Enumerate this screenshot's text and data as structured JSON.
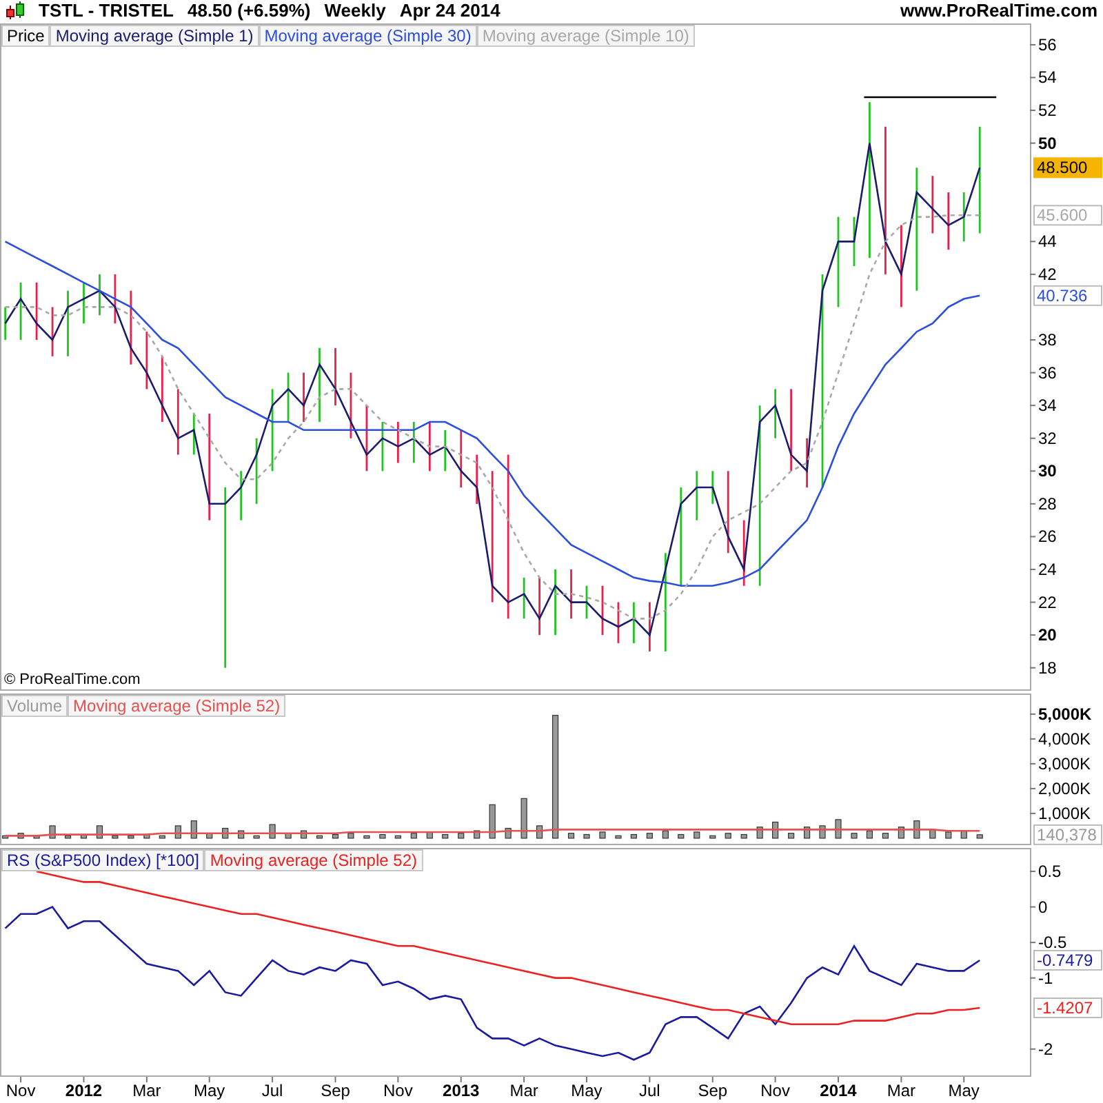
{
  "header": {
    "symbol": "TSTL - TRISTEL",
    "price": "48.50 (+6.59%)",
    "interval": "Weekly",
    "date": "Apr 24 2014",
    "site": "www.ProRealTime.com"
  },
  "panels": [
    {
      "kind": "price",
      "price_label": "Price",
      "copyright": "© ProRealTime.com",
      "chart_data": {
        "type": "line",
        "xlim": [
          2011.778,
          2014.508
        ],
        "ylim": [
          16.6,
          57.3
        ],
        "yticks": [
          56,
          54,
          52,
          50,
          44,
          42,
          38,
          36,
          34,
          32,
          30,
          28,
          26,
          24,
          22,
          20,
          18
        ],
        "ref_lines": [
          {
            "axis": "y",
            "value": 52.8
          }
        ],
        "annotations": [
          "48.500",
          "45.600",
          "40.736"
        ],
        "x": [
          2011.792,
          2011.833,
          2011.875,
          2011.917,
          2011.958,
          2012.0,
          2012.042,
          2012.083,
          2012.125,
          2012.167,
          2012.208,
          2012.25,
          2012.292,
          2012.333,
          2012.375,
          2012.417,
          2012.458,
          2012.5,
          2012.542,
          2012.583,
          2012.625,
          2012.667,
          2012.708,
          2012.75,
          2012.792,
          2012.833,
          2012.875,
          2012.917,
          2012.958,
          2013.0,
          2013.042,
          2013.083,
          2013.125,
          2013.167,
          2013.208,
          2013.25,
          2013.292,
          2013.333,
          2013.375,
          2013.417,
          2013.458,
          2013.5,
          2013.542,
          2013.583,
          2013.625,
          2013.667,
          2013.708,
          2013.75,
          2013.792,
          2013.833,
          2013.875,
          2013.917,
          2013.958,
          2014.0,
          2014.042,
          2014.083,
          2014.125,
          2014.167,
          2014.208,
          2014.25,
          2014.292,
          2014.333,
          2014.375
        ],
        "series": [
          {
            "name": "Moving average (Simple 1)",
            "color": "#1a1a6e",
            "errors": [
              [
                38,
                40
              ],
              [
                38,
                41.5
              ],
              [
                38,
                41.5
              ],
              [
                37,
                40
              ],
              [
                37,
                41
              ],
              [
                39,
                41.5
              ],
              [
                39.5,
                42
              ],
              [
                39,
                42
              ],
              [
                36.5,
                41
              ],
              [
                35,
                38.5
              ],
              [
                33,
                37
              ],
              [
                31,
                35
              ],
              [
                31,
                33.5
              ],
              [
                27,
                33.5
              ],
              [
                18,
                29
              ],
              [
                27,
                30
              ],
              [
                28,
                32
              ],
              [
                30,
                35
              ],
              [
                33,
                36
              ],
              [
                33,
                36
              ],
              [
                33,
                37.5
              ],
              [
                34,
                37.5
              ],
              [
                32,
                36
              ],
              [
                30,
                34
              ],
              [
                30,
                33
              ],
              [
                30.5,
                33
              ],
              [
                30.5,
                33
              ],
              [
                30,
                33
              ],
              [
                30,
                32.5
              ],
              [
                29,
                32.5
              ],
              [
                28,
                31
              ],
              [
                22,
                30
              ],
              [
                21,
                31
              ],
              [
                21,
                23.5
              ],
              [
                20,
                23.5
              ],
              [
                20,
                24
              ],
              [
                21,
                24
              ],
              [
                21,
                23
              ],
              [
                20,
                23
              ],
              [
                19.5,
                22
              ],
              [
                19.5,
                22
              ],
              [
                19,
                22
              ],
              [
                19,
                25
              ],
              [
                23,
                29
              ],
              [
                27,
                30
              ],
              [
                28,
                30
              ],
              [
                25,
                30
              ],
              [
                23,
                27
              ],
              [
                23,
                34
              ],
              [
                32,
                35
              ],
              [
                30,
                35
              ],
              [
                29,
                32
              ],
              [
                29,
                42
              ],
              [
                40,
                45.5
              ],
              [
                42.5,
                45.5
              ],
              [
                43,
                52.5
              ],
              [
                42,
                51
              ],
              [
                40,
                45
              ],
              [
                41,
                48.5
              ],
              [
                44.5,
                48
              ],
              [
                43.5,
                47
              ],
              [
                44,
                47
              ],
              [
                44.5,
                51
              ]
            ],
            "values": [
              39,
              40.5,
              39,
              38,
              40,
              40.5,
              41,
              40,
              37.5,
              36,
              34,
              32,
              32.5,
              28,
              28,
              29,
              31,
              34,
              35,
              34,
              36.5,
              35,
              33,
              31,
              32,
              31.5,
              32,
              31,
              31.5,
              30,
              29,
              23,
              22,
              22.5,
              21,
              23,
              22,
              22,
              21,
              20.5,
              21,
              20,
              24,
              28,
              29,
              29,
              26,
              24,
              33,
              34,
              31,
              30,
              41,
              44,
              44,
              50,
              44,
              42,
              47,
              46,
              45,
              45.5,
              48.5
            ]
          },
          {
            "name": "Moving average (Simple 30)",
            "color": "#2b4de0",
            "values": [
              44,
              43.5,
              43,
              42.5,
              42,
              41.5,
              41,
              40.5,
              40,
              39,
              38,
              37.5,
              36.5,
              35.5,
              34.5,
              34,
              33.5,
              33,
              33,
              32.5,
              32.5,
              32.5,
              32.5,
              32.5,
              32.5,
              32.5,
              32.5,
              33,
              33,
              32.5,
              32,
              31,
              30,
              28.5,
              27.5,
              26.5,
              25.5,
              25,
              24.5,
              24,
              23.5,
              23.3,
              23.2,
              23,
              23,
              23,
              23.2,
              23.5,
              24,
              25,
              26,
              27,
              29,
              31.5,
              33.5,
              35,
              36.5,
              37.5,
              38.5,
              39,
              40,
              40.5,
              40.7
            ]
          },
          {
            "name": "Moving average (Simple 10)",
            "color": "#a8a8a8",
            "line_style": "dashed",
            "values": [
              40,
              40,
              40,
              39.5,
              39.5,
              40,
              40,
              40,
              39.5,
              38.5,
              37,
              35,
              33.5,
              32,
              30.5,
              29.5,
              29.5,
              30.5,
              32,
              33,
              34.5,
              35,
              35,
              34,
              33,
              32.5,
              32,
              31.5,
              31.5,
              31,
              30.5,
              29,
              27,
              25,
              23.5,
              22.5,
              22.5,
              22.3,
              22,
              21.5,
              21,
              21,
              21.5,
              22.5,
              24,
              26,
              27,
              27.5,
              28,
              29,
              30,
              30.5,
              33,
              36,
              39,
              42,
              44,
              45,
              45.5,
              45.5,
              45.6,
              45.6,
              45.6
            ]
          }
        ]
      }
    },
    {
      "kind": "volume",
      "chart_data": {
        "type": "bar",
        "xlim": [
          2011.778,
          2014.508
        ],
        "ylim": [
          -280,
          5830
        ],
        "yticks": [
          {
            "value": 5000,
            "label": "5,000K"
          },
          {
            "value": 4000,
            "label": "4,000K"
          },
          {
            "value": 3000,
            "label": "3,000K"
          },
          {
            "value": 2000,
            "label": "2,000K"
          },
          {
            "value": 1000,
            "label": "1,000K"
          }
        ],
        "annotations": [
          "140,378"
        ],
        "x": [
          2011.792,
          2011.833,
          2011.875,
          2011.917,
          2011.958,
          2012.0,
          2012.042,
          2012.083,
          2012.125,
          2012.167,
          2012.208,
          2012.25,
          2012.292,
          2012.333,
          2012.375,
          2012.417,
          2012.458,
          2012.5,
          2012.542,
          2012.583,
          2012.625,
          2012.667,
          2012.708,
          2012.75,
          2012.792,
          2012.833,
          2012.875,
          2012.917,
          2012.958,
          2013.0,
          2013.042,
          2013.083,
          2013.125,
          2013.167,
          2013.208,
          2013.25,
          2013.292,
          2013.333,
          2013.375,
          2013.417,
          2013.458,
          2013.5,
          2013.542,
          2013.583,
          2013.625,
          2013.667,
          2013.708,
          2013.75,
          2013.792,
          2013.833,
          2013.875,
          2013.917,
          2013.958,
          2014.0,
          2014.042,
          2014.083,
          2014.125,
          2014.167,
          2014.208,
          2014.25,
          2014.292,
          2014.333,
          2014.375
        ],
        "series": [
          {
            "name": "Volume",
            "color": "#999999",
            "values": [
              100,
              200,
              100,
              500,
              100,
              150,
              500,
              100,
              100,
              150,
              100,
              500,
              700,
              200,
              400,
              300,
              100,
              550,
              200,
              300,
              100,
              150,
              200,
              100,
              150,
              100,
              200,
              250,
              150,
              200,
              300,
              1350,
              400,
              1600,
              500,
              4950,
              200,
              150,
              250,
              100,
              150,
              200,
              300,
              150,
              250,
              100,
              200,
              150,
              450,
              650,
              200,
              450,
              500,
              750,
              200,
              300,
              200,
              450,
              700,
              350,
              250,
              300,
              140
            ]
          },
          {
            "name": "Moving average (Simple 52)",
            "color": "#e85050",
            "type": "line",
            "values": [
              100,
              100,
              100,
              150,
              150,
              150,
              150,
              150,
              150,
              150,
              200,
              200,
              200,
              200,
              200,
              200,
              200,
              200,
              200,
              200,
              200,
              200,
              250,
              250,
              250,
              250,
              250,
              250,
              250,
              250,
              250,
              250,
              300,
              300,
              300,
              350,
              350,
              350,
              350,
              350,
              350,
              350,
              350,
              350,
              350,
              350,
              350,
              350,
              350,
              350,
              350,
              350,
              350,
              350,
              350,
              350,
              350,
              350,
              350,
              350,
              300,
              300,
              300
            ]
          }
        ]
      }
    },
    {
      "kind": "rs",
      "chart_data": {
        "type": "line",
        "xlim": [
          2011.778,
          2014.508
        ],
        "ylim": [
          -2.39,
          0.83
        ],
        "yticks": [
          0.5,
          0,
          -0.5,
          -1,
          -2
        ],
        "annotations": [
          "-0.7479",
          "-1.4207"
        ],
        "xticks": [
          {
            "value": 2011.833,
            "label": "Nov"
          },
          {
            "value": 2012,
            "label": "2012"
          },
          {
            "value": 2012.167,
            "label": "Mar"
          },
          {
            "value": 2012.333,
            "label": "May"
          },
          {
            "value": 2012.5,
            "label": "Jul"
          },
          {
            "value": 2012.667,
            "label": "Sep"
          },
          {
            "value": 2012.833,
            "label": "Nov"
          },
          {
            "value": 2013,
            "label": "2013"
          },
          {
            "value": 2013.167,
            "label": "Mar"
          },
          {
            "value": 2013.333,
            "label": "May"
          },
          {
            "value": 2013.5,
            "label": "Jul"
          },
          {
            "value": 2013.667,
            "label": "Sep"
          },
          {
            "value": 2013.833,
            "label": "Nov"
          },
          {
            "value": 2014,
            "label": "2014"
          },
          {
            "value": 2014.167,
            "label": "Mar"
          },
          {
            "value": 2014.333,
            "label": "May"
          }
        ],
        "x": [
          2011.792,
          2011.833,
          2011.875,
          2011.917,
          2011.958,
          2012.0,
          2012.042,
          2012.083,
          2012.125,
          2012.167,
          2012.208,
          2012.25,
          2012.292,
          2012.333,
          2012.375,
          2012.417,
          2012.458,
          2012.5,
          2012.542,
          2012.583,
          2012.625,
          2012.667,
          2012.708,
          2012.75,
          2012.792,
          2012.833,
          2012.875,
          2012.917,
          2012.958,
          2013.0,
          2013.042,
          2013.083,
          2013.125,
          2013.167,
          2013.208,
          2013.25,
          2013.292,
          2013.333,
          2013.375,
          2013.417,
          2013.458,
          2013.5,
          2013.542,
          2013.583,
          2013.625,
          2013.667,
          2013.708,
          2013.75,
          2013.792,
          2013.833,
          2013.875,
          2013.917,
          2013.958,
          2014.0,
          2014.042,
          2014.083,
          2014.125,
          2014.167,
          2014.208,
          2014.25,
          2014.292,
          2014.333,
          2014.375
        ],
        "series": [
          {
            "name": "RS (S&P500 Index) [*100]",
            "color": "#1a1aa0",
            "values": [
              -0.3,
              -0.1,
              -0.1,
              0,
              -0.3,
              -0.2,
              -0.2,
              -0.4,
              -0.6,
              -0.8,
              -0.85,
              -0.9,
              -1.1,
              -0.9,
              -1.2,
              -1.25,
              -1,
              -0.75,
              -0.9,
              -0.95,
              -0.85,
              -0.9,
              -0.75,
              -0.8,
              -1.1,
              -1.05,
              -1.15,
              -1.3,
              -1.25,
              -1.3,
              -1.7,
              -1.85,
              -1.85,
              -1.95,
              -1.85,
              -1.95,
              -2,
              -2.05,
              -2.1,
              -2.05,
              -2.15,
              -2.05,
              -1.65,
              -1.55,
              -1.55,
              -1.7,
              -1.85,
              -1.5,
              -1.4,
              -1.65,
              -1.35,
              -1,
              -0.85,
              -0.95,
              -0.55,
              -0.9,
              -1,
              -1.1,
              -0.8,
              -0.85,
              -0.9,
              -0.9,
              -0.75
            ]
          },
          {
            "name": "Moving average (Simple 52)",
            "color": "#ee2020",
            "values": [
              null,
              null,
              0.5,
              0.45,
              0.4,
              0.35,
              0.35,
              0.3,
              0.25,
              0.2,
              0.15,
              0.1,
              0.05,
              0,
              -0.05,
              -0.1,
              -0.1,
              -0.15,
              -0.2,
              -0.25,
              -0.3,
              -0.35,
              -0.4,
              -0.45,
              -0.5,
              -0.55,
              -0.55,
              -0.6,
              -0.65,
              -0.7,
              -0.75,
              -0.8,
              -0.85,
              -0.9,
              -0.95,
              -1,
              -1,
              -1.05,
              -1.1,
              -1.15,
              -1.2,
              -1.25,
              -1.3,
              -1.35,
              -1.4,
              -1.45,
              -1.45,
              -1.5,
              -1.55,
              -1.6,
              -1.65,
              -1.65,
              -1.65,
              -1.65,
              -1.6,
              -1.6,
              -1.6,
              -1.55,
              -1.5,
              -1.5,
              -1.45,
              -1.45,
              -1.42
            ]
          }
        ]
      }
    }
  ]
}
